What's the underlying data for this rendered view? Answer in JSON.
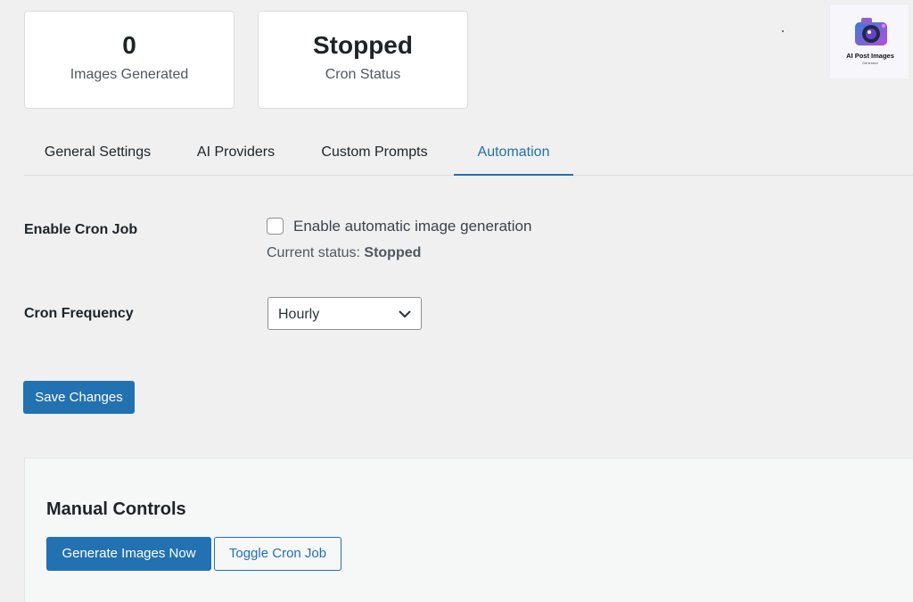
{
  "stats": [
    {
      "value": "0",
      "label": "Images Generated"
    },
    {
      "value": "Stopped",
      "label": "Cron Status"
    }
  ],
  "logo": {
    "text_line1": "AI Post Images",
    "text_line2": "Generator",
    "icon": "camera-logo-icon"
  },
  "tabs": [
    {
      "label": "General Settings",
      "active": false
    },
    {
      "label": "AI Providers",
      "active": false
    },
    {
      "label": "Custom Prompts",
      "active": false
    },
    {
      "label": "Automation",
      "active": true
    }
  ],
  "form": {
    "cron_label": "Enable Cron Job",
    "checkbox_label": "Enable automatic image generation",
    "checkbox_checked": false,
    "status_prefix": "Current status:",
    "status_value": "Stopped",
    "frequency_label": "Cron Frequency",
    "frequency_value": "Hourly"
  },
  "save_button": "Save Changes",
  "manual": {
    "title": "Manual Controls",
    "generate_button": "Generate Images Now",
    "toggle_button": "Toggle Cron Job"
  },
  "colors": {
    "accent": "#2271b1",
    "background": "#f0f0f1",
    "card": "#ffffff",
    "text": "#1d2327"
  }
}
